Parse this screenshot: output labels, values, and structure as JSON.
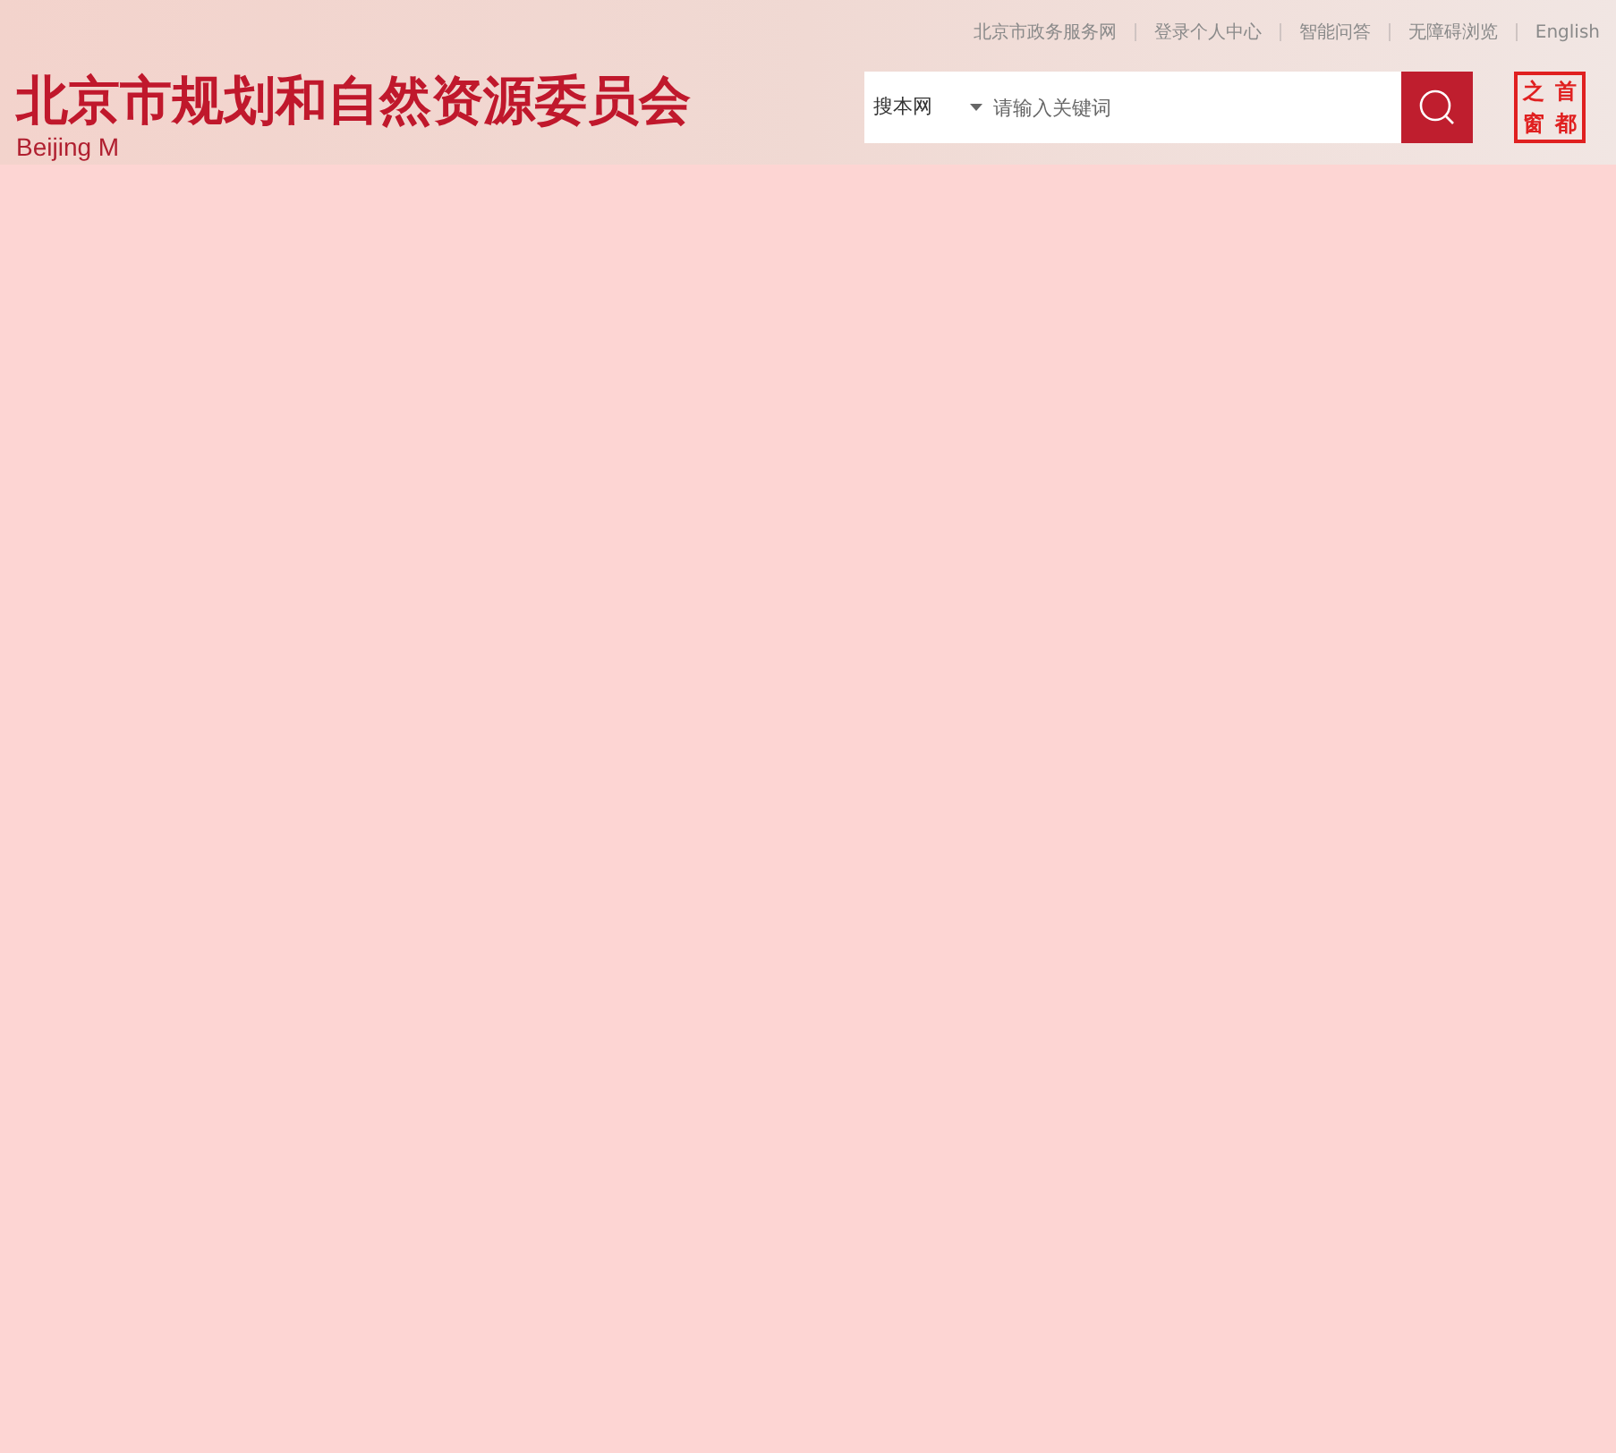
{
  "top_links": [
    {
      "label": "北京市政务服务网"
    },
    {
      "label": "登录个人中心"
    },
    {
      "label": "智能问答"
    },
    {
      "label": "无障碍浏览"
    },
    {
      "label": "English"
    }
  ],
  "site_title": "北京市规划和自然资源委员会",
  "site_subtitle": "Beijing M",
  "search": {
    "scope": "搜本网",
    "placeholder": "请输入关键词"
  },
  "logo": {
    "characters": [
      "之",
      "首",
      "窗",
      "都"
    ]
  }
}
